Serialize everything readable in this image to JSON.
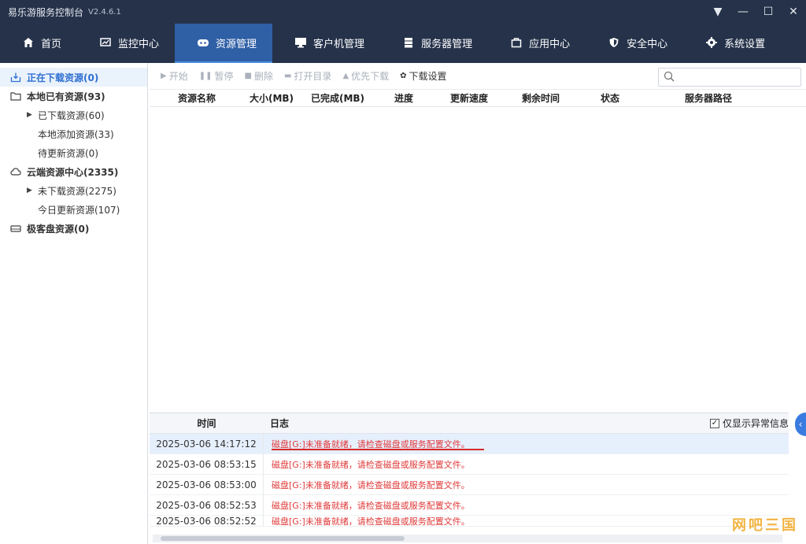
{
  "app": {
    "title": "易乐游服务控制台",
    "version": "V2.4.6.1"
  },
  "window": {
    "menu": "▼",
    "minimize": "—",
    "maximize": "☐",
    "close": "✕"
  },
  "nav": [
    {
      "label": "首页",
      "icon": "home-icon"
    },
    {
      "label": "监控中心",
      "icon": "monitor-chart-icon"
    },
    {
      "label": "资源管理",
      "icon": "resource-icon",
      "active": true
    },
    {
      "label": "客户机管理",
      "icon": "client-monitor-icon"
    },
    {
      "label": "服务器管理",
      "icon": "server-icon"
    },
    {
      "label": "应用中心",
      "icon": "app-box-icon"
    },
    {
      "label": "安全中心",
      "icon": "shield-icon"
    },
    {
      "label": "系统设置",
      "icon": "gear-icon"
    }
  ],
  "sidebar": {
    "downloading": "正在下载资源(0)",
    "local": "本地已有资源(93)",
    "local_downloaded": "已下载资源(60)",
    "local_added": "本地添加资源(33)",
    "local_pending": "待更新资源(0)",
    "cloud": "云端资源中心(2335)",
    "cloud_not_downloaded": "未下载资源(2275)",
    "cloud_today": "今日更新资源(107)",
    "ssd": "极客盘资源(0)"
  },
  "toolbar": {
    "start": "开始",
    "pause": "暂停",
    "delete": "删除",
    "open_dir": "打开目录",
    "priority": "优先下载",
    "settings": "下载设置",
    "search_placeholder": ""
  },
  "table": {
    "columns": [
      "资源名称",
      "大小(MB)",
      "已完成(MB)",
      "进度",
      "更新速度",
      "剩余时间",
      "状态",
      "服务器路径"
    ]
  },
  "log": {
    "col_time": "时间",
    "col_log": "日志",
    "filter_label": "仅显示异常信息",
    "filter_checked": true,
    "rows": [
      {
        "time": "2025-03-06 14:17:12",
        "msg": "磁盘[G:]未准备就绪，请检查磁盘或服务配置文件。"
      },
      {
        "time": "2025-03-06 08:53:15",
        "msg": "磁盘[G:]未准备就绪，请检查磁盘或服务配置文件。"
      },
      {
        "time": "2025-03-06 08:53:00",
        "msg": "磁盘[G:]未准备就绪，请检查磁盘或服务配置文件。"
      },
      {
        "time": "2025-03-06 08:52:53",
        "msg": "磁盘[G:]未准备就绪，请检查磁盘或服务配置文件。"
      },
      {
        "time": "2025-03-06 08:52:52",
        "msg": "磁盘[G:]未准备就绪，请检查磁盘或服务配置文件。"
      }
    ]
  },
  "watermark": "网吧三国",
  "colors": {
    "titlebar": "#25324a",
    "nav_active": "#2f5fa5",
    "error_text": "#e03a3a",
    "selected_row": "#e6effc"
  }
}
